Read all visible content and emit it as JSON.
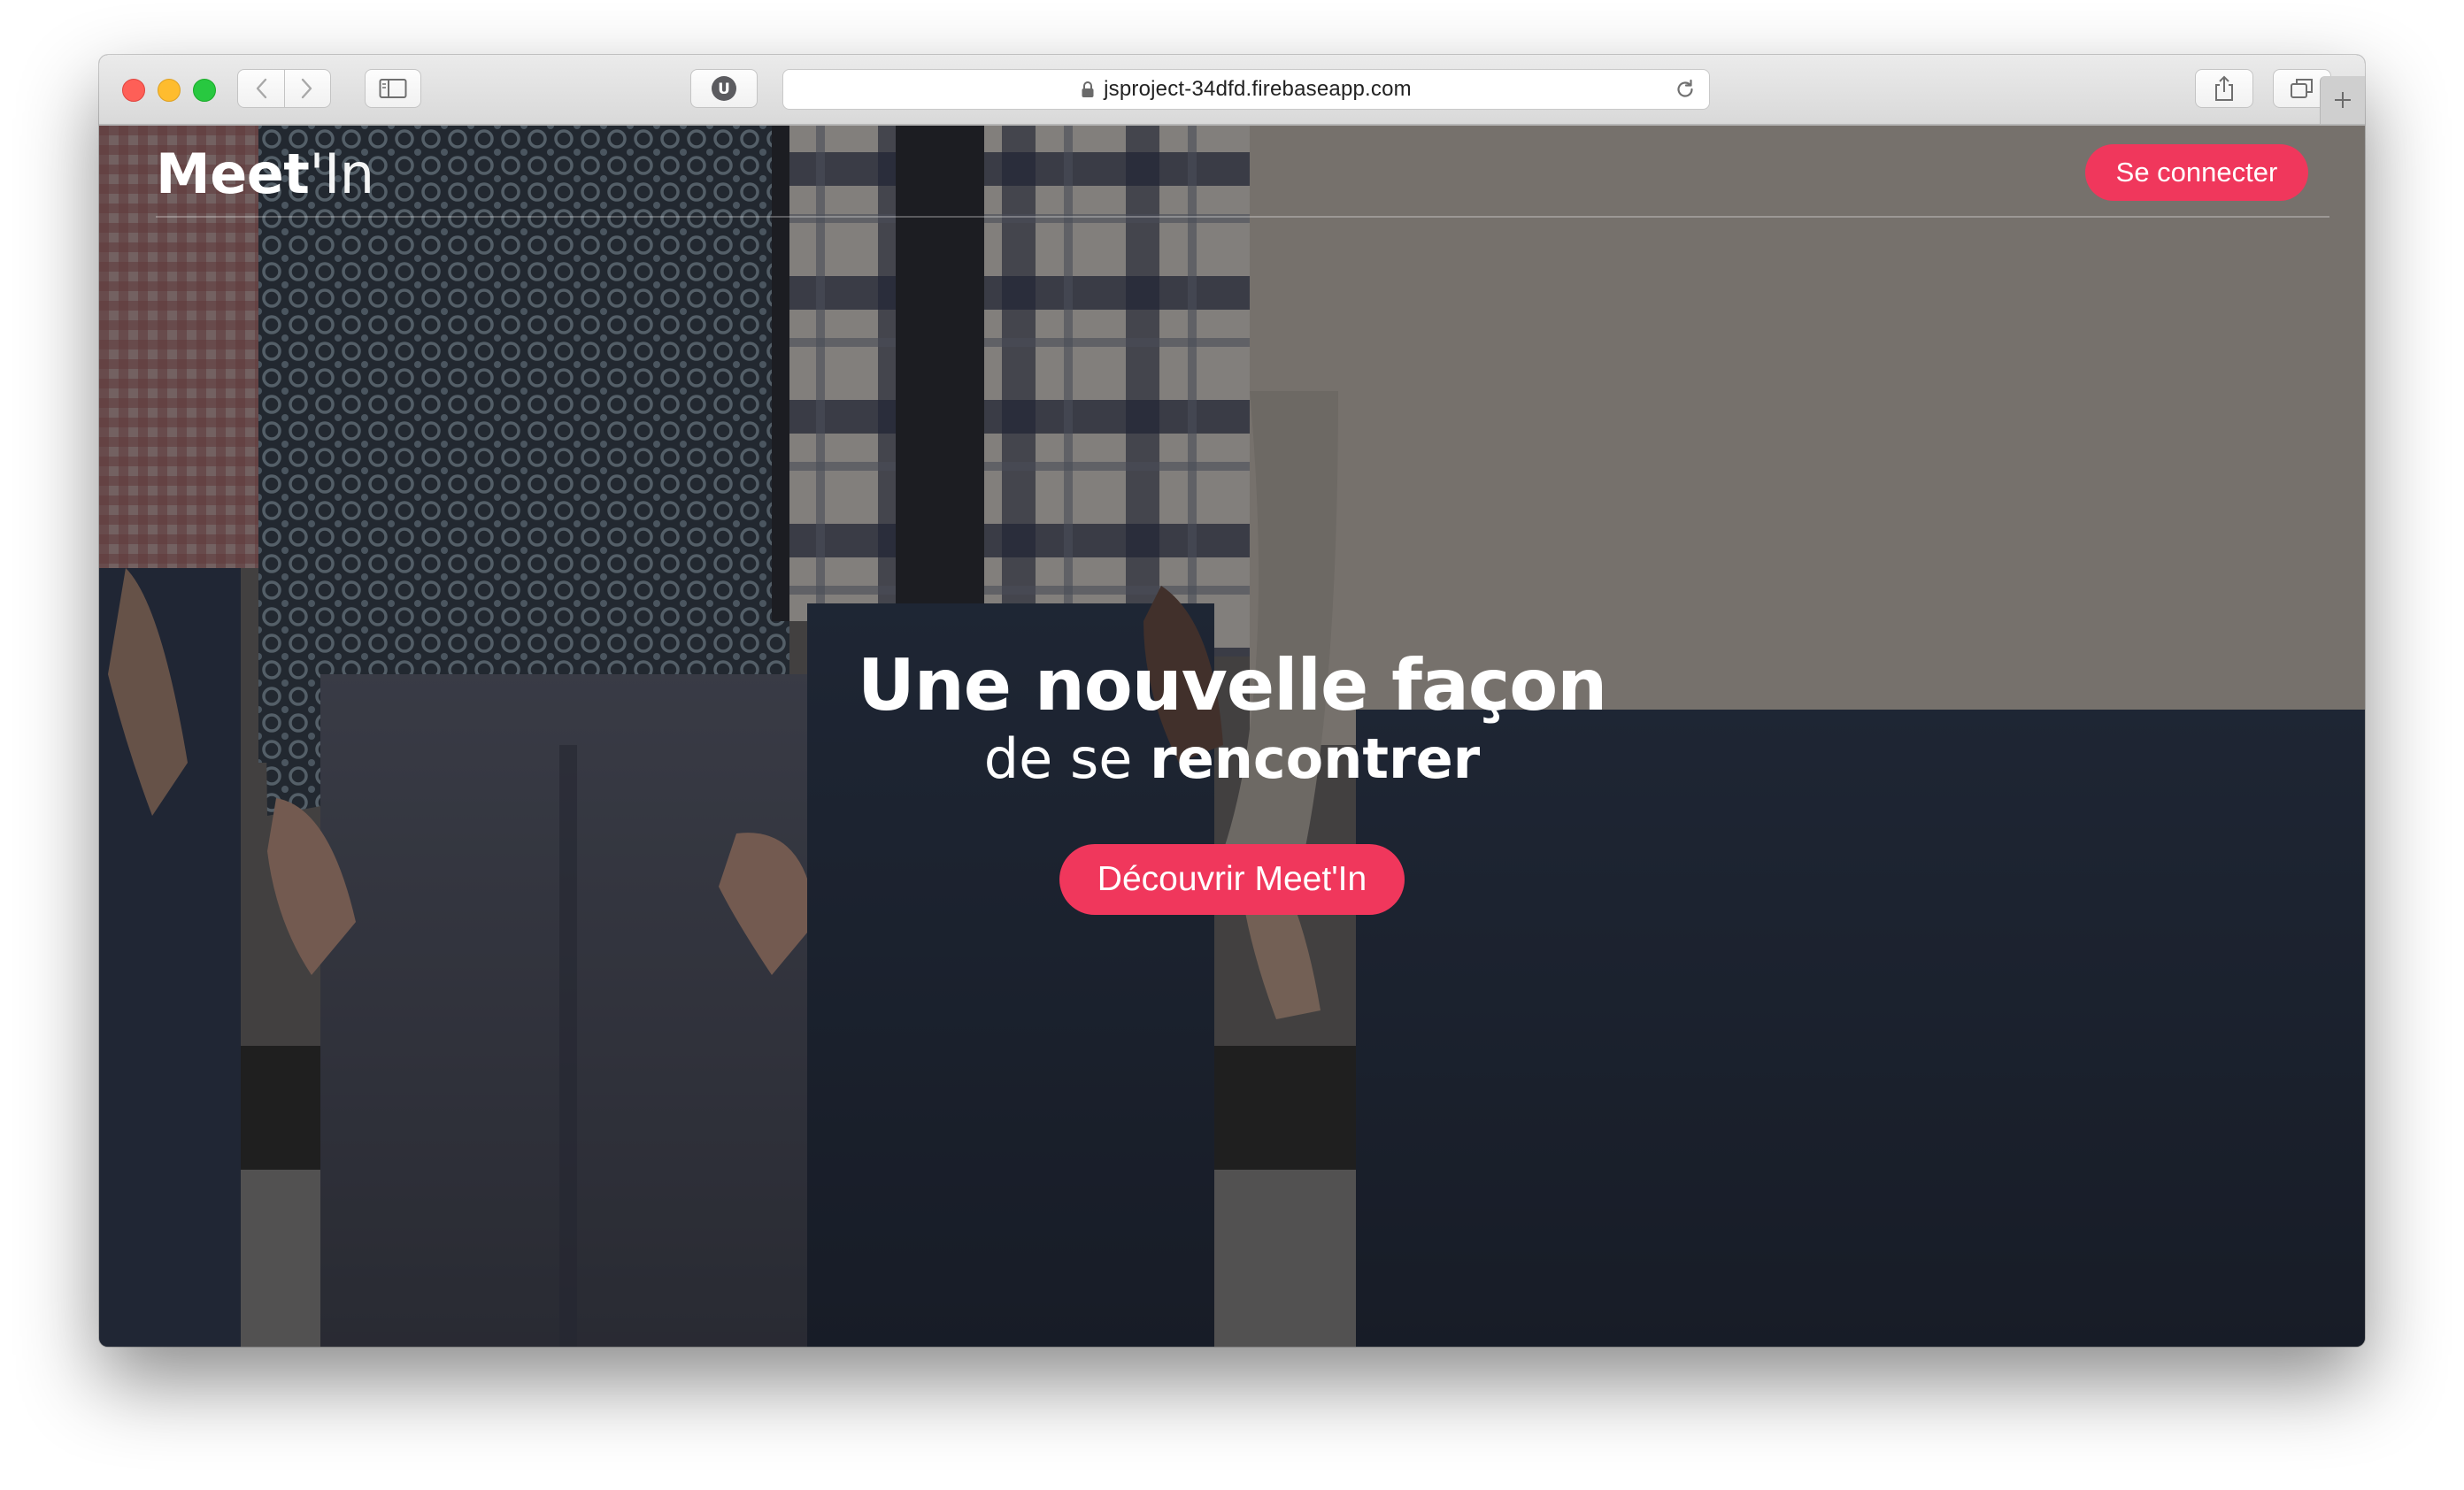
{
  "browser": {
    "url": "jsproject-34dfd.firebaseapp.com",
    "extension_badge": "U",
    "icons": [
      "close-window",
      "minimize-window",
      "zoom-window",
      "back-icon",
      "forward-icon",
      "sidebar-icon",
      "lock-icon",
      "reload-icon",
      "share-icon",
      "tabs-icon",
      "plus-icon"
    ]
  },
  "site": {
    "logo_bold": "Meet",
    "logo_light": "'In",
    "connect_label": "Se connecter"
  },
  "hero": {
    "title": "Une nouvelle façon",
    "subtitle_light": "de se",
    "subtitle_bold": "rencontrer",
    "cta_label": "Découvrir Meet'In"
  },
  "colors": {
    "accent": "#f0375c",
    "toolbar": "#e2e2e2",
    "text_on_dark": "#ffffff"
  }
}
